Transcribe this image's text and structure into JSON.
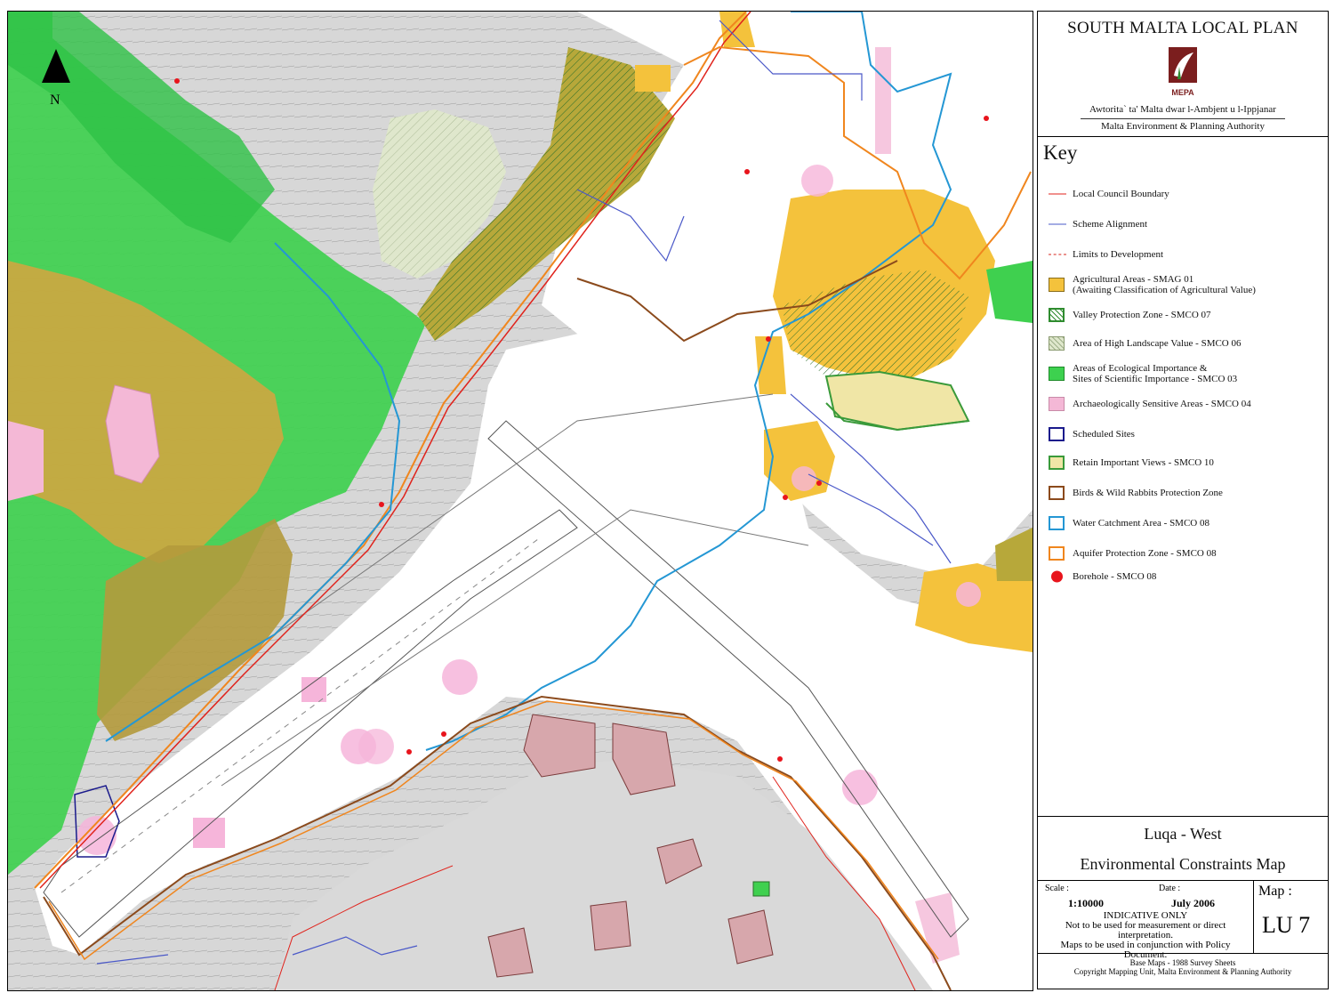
{
  "header": {
    "plan_title": "SOUTH MALTA LOCAL PLAN",
    "logo_text": "MEPA",
    "authority_maltese": "Awtorita` ta' Malta dwar l-Ambjent u l-Ippjanar",
    "authority_english": "Malta Environment & Planning Authority"
  },
  "key": {
    "title": "Key",
    "items": [
      {
        "label": "Local Council Boundary",
        "symbol": "line",
        "color": "#e0231c"
      },
      {
        "label": "Scheme Alignment",
        "symbol": "line",
        "color": "#4a58c8"
      },
      {
        "label": "Limits to Development",
        "symbol": "dashdot",
        "color": "#d7261e"
      },
      {
        "label": "Agricultural Areas - SMAG 01",
        "label2": "(Awaiting Classification of Agricultural Value)",
        "symbol": "box",
        "color": "#f4c23c"
      },
      {
        "label": "Valley Protection Zone - SMCO 07",
        "symbol": "hatch",
        "color": "#2f8c2f"
      },
      {
        "label": "Area of High Landscape Value - SMCO 06",
        "symbol": "hatch-light",
        "color": "#dfe7cc"
      },
      {
        "label": "Areas of Ecological Importance &",
        "label2": "Sites of Scientific Importance - SMCO 03",
        "symbol": "box",
        "color": "#3dd14f"
      },
      {
        "label": "Archaeologically Sensitive Areas - SMCO 04",
        "symbol": "box",
        "color": "#f4b8d6"
      },
      {
        "label": "Scheduled Sites",
        "symbol": "outline",
        "color": "#1a1a8c"
      },
      {
        "label": "Retain Important Views - SMCO 10",
        "symbol": "box-outline",
        "color": "#f0e6a6",
        "outline": "#3a9a3a"
      },
      {
        "label": "Birds & Wild Rabbits Protection Zone",
        "symbol": "outline",
        "color": "#8b4a1c"
      },
      {
        "label": "Water Catchment Area - SMCO 08",
        "symbol": "outline",
        "color": "#2497d4"
      },
      {
        "label": "Aquifer Protection Zone - SMCO 08",
        "symbol": "outline",
        "color": "#f0861e"
      },
      {
        "label": "Borehole - SMCO 08",
        "symbol": "dot",
        "color": "#e8141c"
      }
    ]
  },
  "map": {
    "locality": "Luqa - West",
    "title": "Environmental Constraints Map",
    "north_label": "N"
  },
  "info": {
    "scale_label": "Scale :",
    "scale_value": "1:10000",
    "date_label": "Date :",
    "date_value": "July 2006",
    "indicative_title": "INDICATIVE ONLY",
    "indicative_line1": "Not to be used for measurement or direct interpretation.",
    "indicative_line2": "Maps to be used in conjunction with Policy Document.",
    "map_label": "Map :",
    "map_number": "LU 7"
  },
  "footer": {
    "line1": "Base Maps - 1988 Survey Sheets",
    "line2": "Copyright Mapping Unit, Malta Environment & Planning Authority"
  }
}
